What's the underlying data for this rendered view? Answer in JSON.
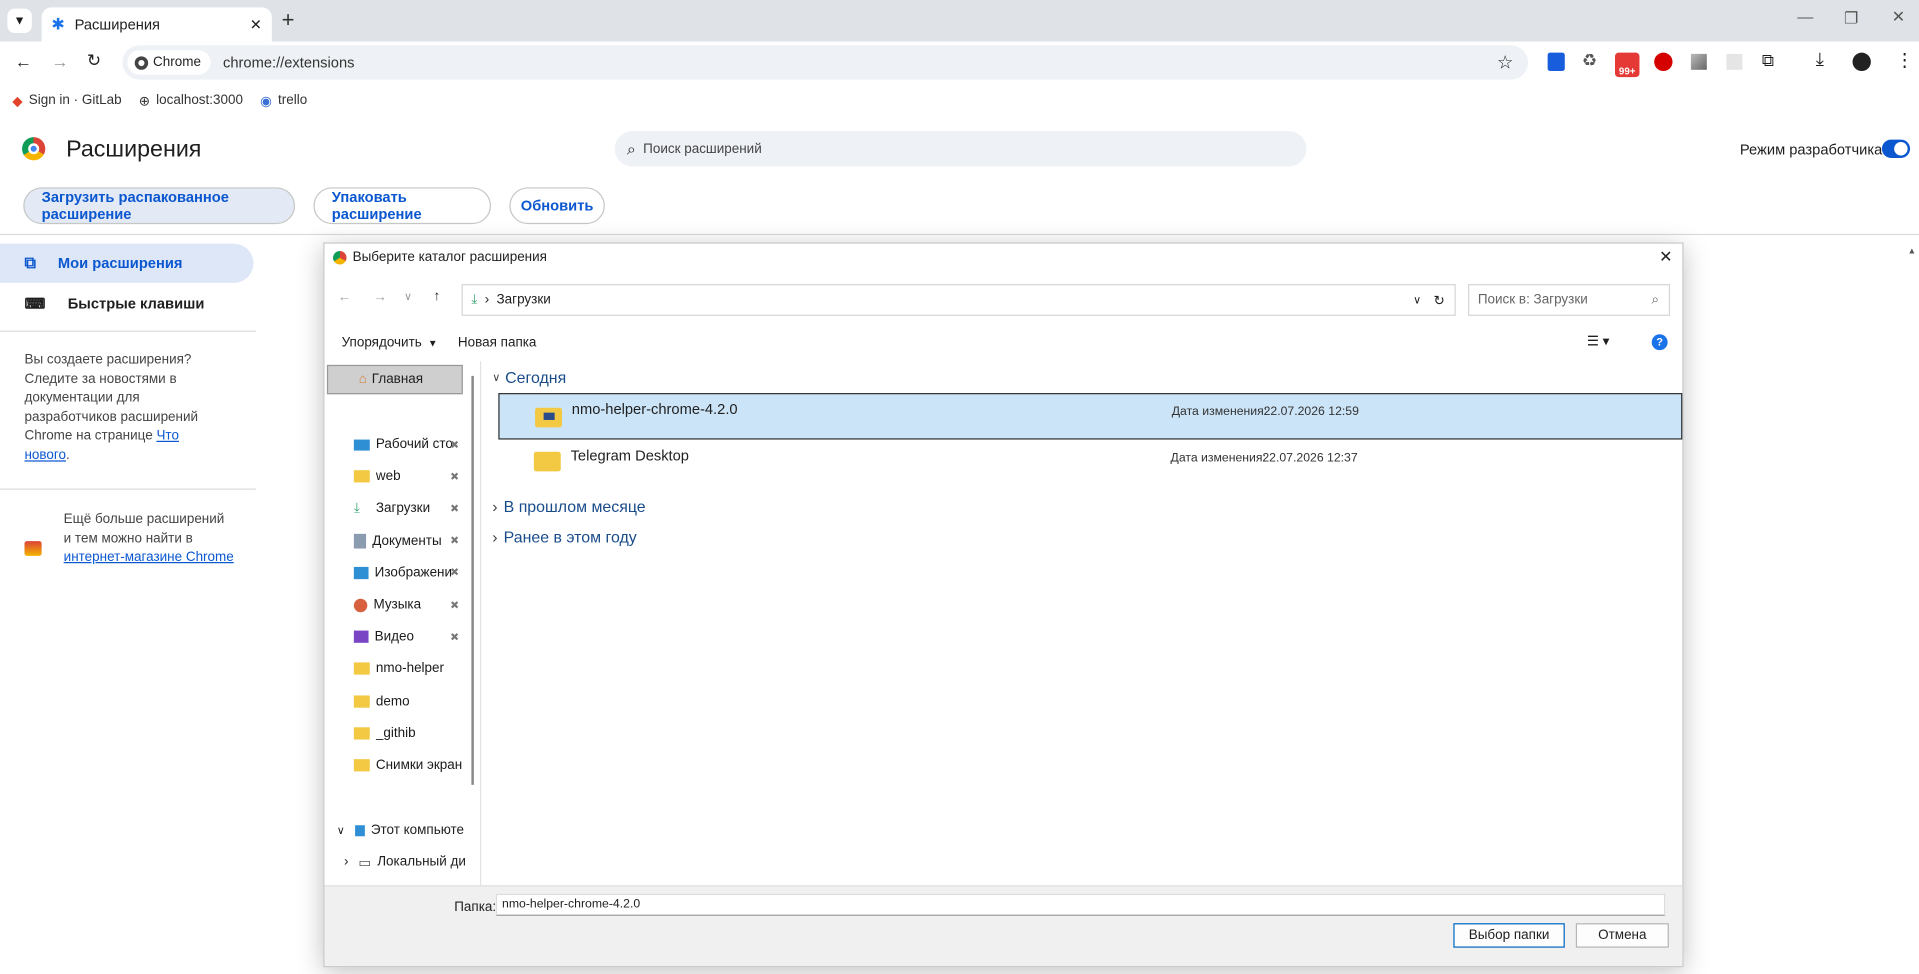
{
  "browser": {
    "tab_title": "Расширения",
    "chip_label": "Chrome",
    "url": "chrome://extensions",
    "badge_count": "99+",
    "bookmarks": [
      "Sign in · GitLab",
      "localhost:3000",
      "trello"
    ]
  },
  "extensions_page": {
    "title": "Расширения",
    "search_placeholder": "Поиск расширений",
    "dev_mode_label": "Режим разработчика",
    "dev_mode_on": true,
    "load_unpacked": "Загрузить распакованное расширение",
    "pack": "Упаковать расширение",
    "update": "Обновить",
    "nav_my": "Мои расширения",
    "nav_shortcuts": "Быстрые клавиши",
    "dev_promo_text": "Вы создаете расширения? Следите за новостями в документации для разработчиков расширений Chrome на странице",
    "dev_promo_link": "Что нового",
    "store_text": "Ещё больше расширений и тем можно найти в",
    "store_link": "интернет-магазине Chrome"
  },
  "dialog": {
    "title": "Выберите каталог расширения",
    "breadcrumb": "Загрузки",
    "search_placeholder": "Поиск в: Загрузки",
    "organize": "Упорядочить",
    "new_folder": "Новая папка",
    "home": "Главная",
    "quick_access": [
      {
        "label": "Рабочий сто",
        "pinned": true,
        "icon": "desktop-icon"
      },
      {
        "label": "web",
        "pinned": true,
        "icon": "folder-icon"
      },
      {
        "label": "Загрузки",
        "pinned": true,
        "icon": "download-icon"
      },
      {
        "label": "Документы",
        "pinned": true,
        "icon": "documents-icon"
      },
      {
        "label": "Изображени",
        "pinned": true,
        "icon": "pictures-icon"
      },
      {
        "label": "Музыка",
        "pinned": true,
        "icon": "music-icon"
      },
      {
        "label": "Видео",
        "pinned": true,
        "icon": "video-icon"
      },
      {
        "label": "nmo-helper",
        "pinned": false,
        "icon": "folder-icon"
      },
      {
        "label": "demo",
        "pinned": false,
        "icon": "folder-icon"
      },
      {
        "label": "_githib",
        "pinned": false,
        "icon": "folder-icon"
      },
      {
        "label": "Снимки экрана",
        "pinned": false,
        "icon": "folder-icon"
      }
    ],
    "this_pc": "Этот компьюте",
    "local_disk": "Локальный ди",
    "groups": {
      "today": "Сегодня",
      "last_month": "В прошлом месяце",
      "this_year": "Ранее в этом году"
    },
    "files": [
      {
        "name": "nmo-helper-chrome-4.2.0",
        "date_label": "Дата изменения:",
        "date": "22.07.2026 12:59",
        "selected": true
      },
      {
        "name": "Telegram Desktop",
        "date_label": "Дата изменения:",
        "date": "22.07.2026 12:37",
        "selected": false
      }
    ],
    "folder_label": "Папка:",
    "folder_value": "nmo-helper-chrome-4.2.0",
    "select_button": "Выбор папки",
    "cancel_button": "Отмена"
  }
}
